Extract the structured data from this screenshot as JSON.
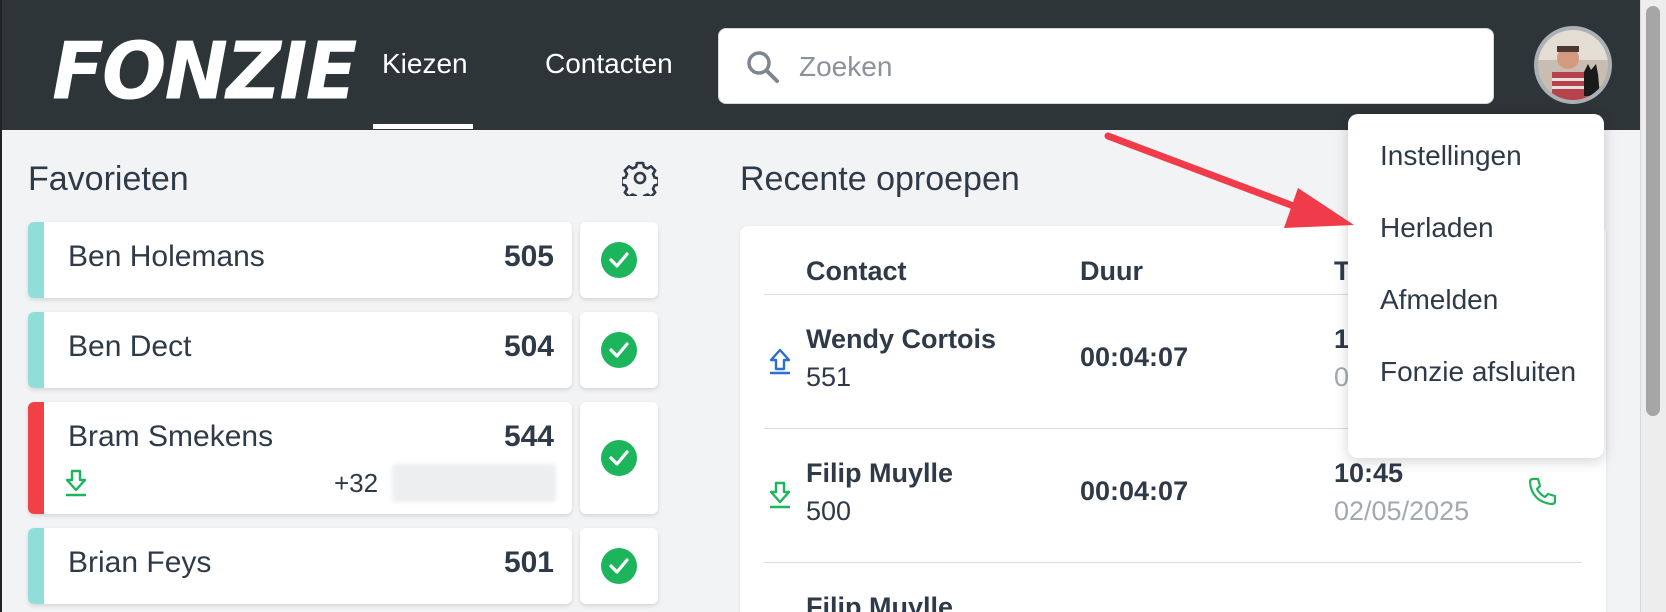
{
  "app": {
    "logo": "FONZIE"
  },
  "nav": {
    "tabs": [
      {
        "label": "Kiezen",
        "active": true
      },
      {
        "label": "Contacten",
        "active": false
      }
    ]
  },
  "search": {
    "placeholder": "Zoeken",
    "value": ""
  },
  "favorites": {
    "title": "Favorieten",
    "items": [
      {
        "name": "Ben Holemans",
        "ext": "505",
        "state": "available"
      },
      {
        "name": "Ben Dect",
        "ext": "504",
        "state": "available"
      },
      {
        "name": "Bram Smekens",
        "ext": "544",
        "state": "busy",
        "incoming_prefix": "+32"
      },
      {
        "name": "Brian Feys",
        "ext": "501",
        "state": "available"
      }
    ]
  },
  "recent": {
    "title": "Recente oproepen",
    "columns": [
      "Contact",
      "Duur",
      "T"
    ],
    "rows": [
      {
        "direction": "outgoing",
        "name": "Wendy Cortois",
        "number": "551",
        "duration": "00:04:07",
        "time": "1",
        "date": "0"
      },
      {
        "direction": "incoming",
        "name": "Filip Muylle",
        "number": "500",
        "duration": "00:04:07",
        "time": "10:45",
        "date": "02/05/2025"
      },
      {
        "direction": "incoming",
        "name": "Filip Muylle",
        "number": "",
        "duration": "",
        "time": "",
        "date": ""
      }
    ]
  },
  "menu": {
    "items": [
      "Instellingen",
      "Herladen",
      "Afmelden",
      "Fonzie afsluiten"
    ]
  },
  "colors": {
    "header": "#2e3538",
    "available_bar": "#8fdfd8",
    "busy_bar": "#ef4146",
    "status_ok": "#1cb55b",
    "annotation_arrow": "#ef3b4a"
  }
}
